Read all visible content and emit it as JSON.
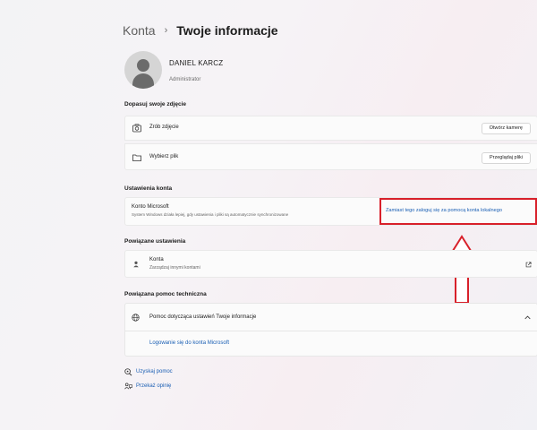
{
  "breadcrumb": {
    "parent": "Konta",
    "separator": "›",
    "current": "Twoje informacje"
  },
  "user": {
    "name": "DANIEL KARCZ",
    "role": "Administrator"
  },
  "photo_section": {
    "title": "Dopasuj swoje zdjęcie",
    "take_photo": {
      "label": "Zrób zdjęcie",
      "button": "Otwórz kamerę"
    },
    "choose_file": {
      "label": "Wybierz plik",
      "button": "Przeglądaj pliki"
    }
  },
  "account_section": {
    "title": "Ustawienia konta",
    "microsoft_title": "Konto Microsoft",
    "microsoft_desc": "System Windows działa lepiej, gdy ustawienia i pliki są automatycznie synchronizowane",
    "local_link": "Zamiast tego zaloguj się za pomocą konta lokalnego"
  },
  "related_section": {
    "title": "Powiązane ustawienia",
    "accounts_title": "Konta",
    "accounts_desc": "Zarządzaj innymi kontami"
  },
  "support_section": {
    "title": "Powiązana pomoc techniczna",
    "help_title": "Pomoc dotycząca ustawień Twoje informacje",
    "help_link": "Logowanie się do konta Microsoft"
  },
  "footer": {
    "get_help": "Uzyskaj pomoc",
    "feedback": "Przekaż opinię"
  },
  "colors": {
    "accent": "#1a5fb4",
    "highlight": "#d8202a",
    "card": "#fbfbfb"
  }
}
